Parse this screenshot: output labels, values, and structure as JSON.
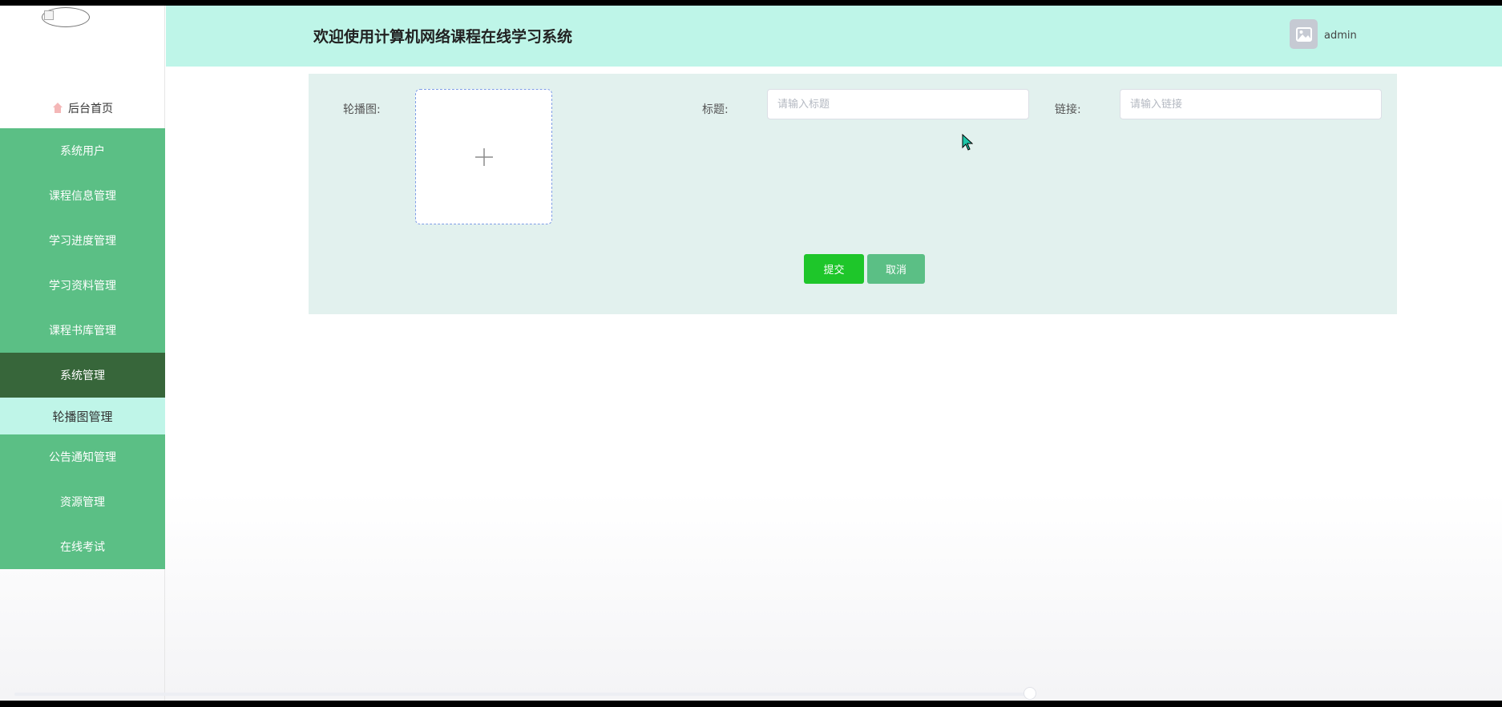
{
  "header": {
    "title": "欢迎使用计算机网络课程在线学习系统",
    "username": "admin"
  },
  "sidebar": {
    "home_label": "后台首页",
    "items": [
      {
        "label": "系统用户"
      },
      {
        "label": "课程信息管理"
      },
      {
        "label": "学习进度管理"
      },
      {
        "label": "学习资料管理"
      },
      {
        "label": "课程书库管理"
      },
      {
        "label": "系统管理"
      },
      {
        "label": "轮播图管理"
      },
      {
        "label": "公告通知管理"
      },
      {
        "label": "资源管理"
      },
      {
        "label": "在线考试"
      }
    ]
  },
  "form": {
    "carousel_label": "轮播图:",
    "title_label": "标题:",
    "title_placeholder": "请输入标题",
    "title_value": "",
    "link_label": "链接:",
    "link_placeholder": "请输入链接",
    "link_value": "",
    "submit_label": "提交",
    "cancel_label": "取消"
  },
  "colors": {
    "header_bg": "#bef5e8",
    "menu_bg": "#5bbf85",
    "menu_active_bg": "#37663a",
    "submenu_bg": "#bff5e8",
    "panel_bg": "#e2f1ee",
    "submit_bg": "#1ec62a"
  }
}
